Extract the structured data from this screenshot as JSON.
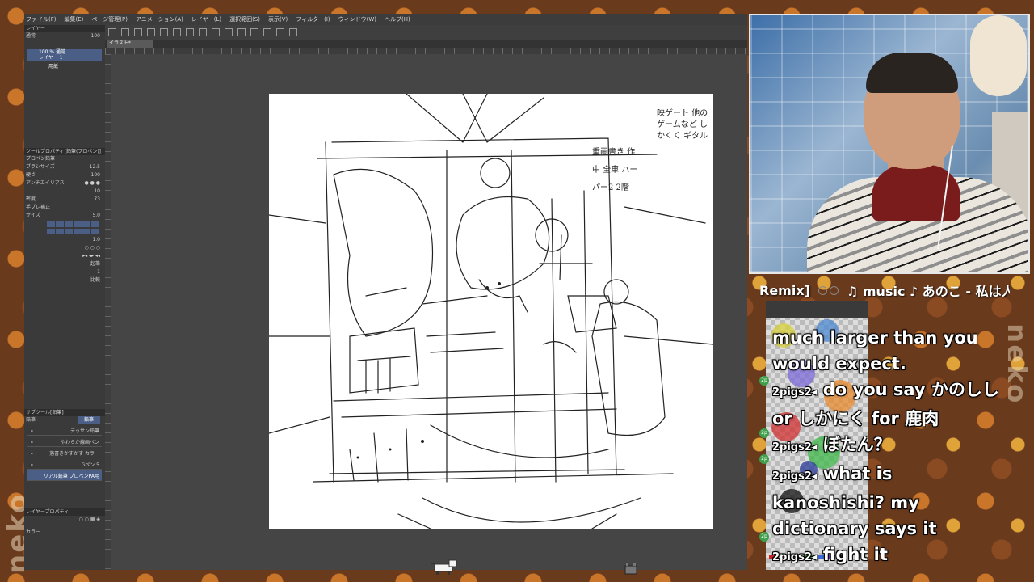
{
  "menu": [
    "ファイル(F)",
    "編集(E)",
    "ページ管理(P)",
    "アニメーション(A)",
    "レイヤー(L)",
    "選択範囲(S)",
    "表示(V)",
    "フィルター(I)",
    "ウィンドウ(W)",
    "ヘルプ(H)"
  ],
  "tab_label": "イラスト*",
  "left_panel": {
    "layer_header": "レイヤー",
    "blend_mode": "通常",
    "opacity_value": "100",
    "layer_1_line1": "100 % 通常",
    "layer_1_line2": "レイヤー 1",
    "layer_2": "用紙",
    "tool_property_header": "ツールプロパティ[鉛筆(プロペン)]",
    "brush_name": "プロペン鉛筆",
    "props": [
      {
        "label": "ブラシサイズ",
        "value": "12.5"
      },
      {
        "label": "硬さ",
        "value": "100"
      },
      {
        "label": "アンチエイリアス",
        "value": ""
      },
      {
        "label": "",
        "value": "10"
      },
      {
        "label": "密度",
        "value": "73"
      },
      {
        "label": "手ブレ補正",
        "value": ""
      },
      {
        "label": "サイズ",
        "value": "5.0"
      },
      {
        "label": "",
        "value": "1.0"
      },
      {
        "label": "",
        "value": "1"
      }
    ],
    "stroke_label": "起筆",
    "compare_label": "比較",
    "sub_tool_header": "サブツール[鉛筆]",
    "sub_tool_tab1": "鉛筆",
    "sub_tool_tab2": "鉛筆",
    "sub_tools": [
      "デッサン鉛筆",
      "やわらか線画ペン",
      "落書きかすかす カラー",
      "Gペン 5",
      "リアル鉛筆 プロペンPA用"
    ],
    "layer_property_header": "レイヤープロパティ",
    "color_label": "カラー"
  },
  "canvas_notes": {
    "note_top_right": "映ゲート 他のゲームなど しかくく ギタル",
    "note_mid": "重画書き 作中 全車 ハーパー2 2階"
  },
  "now_playing": {
    "left": "Remix]",
    "right": "♫ music ♪ あのこ - 私は人"
  },
  "chat": [
    {
      "user": "",
      "text": "much larger than you would expect."
    },
    {
      "user": "2pigs2",
      "text": "do you say かのしし or しかにく for 鹿肉"
    },
    {
      "user": "2pigs2",
      "text": "ぼたん？"
    },
    {
      "user": "2pigs2",
      "text": "what is kanoshishi? my dictionary says it"
    },
    {
      "user": "2pigs2",
      "text": "fight it"
    }
  ],
  "badge_label": "2p",
  "overlay_text": "neko"
}
